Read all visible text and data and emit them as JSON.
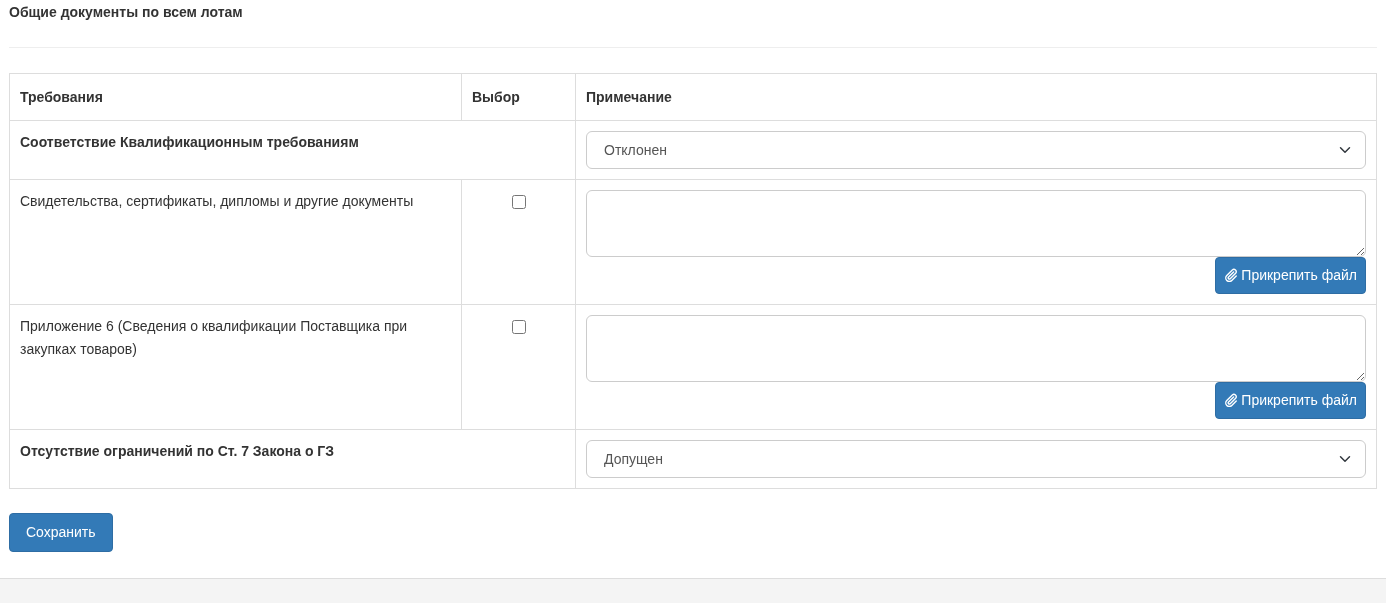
{
  "heading": "Общие документы по всем лотам",
  "table": {
    "columns": [
      "Требования",
      "Выбор",
      "Примечание"
    ],
    "rows": [
      {
        "kind": "group",
        "requirement": "Соответствие Квалификационным требованиям",
        "status": "Отклонен"
      },
      {
        "kind": "document",
        "requirement": "Свидетельства, сертификаты, дипломы и другие документы",
        "checked": false,
        "attach_button": "Прикрепить файл"
      },
      {
        "kind": "document",
        "requirement": "Приложение 6 (Сведения о квалификации Поставщика при закупках товаров)",
        "checked": false,
        "attach_button": "Прикрепить файл"
      },
      {
        "kind": "group",
        "requirement": "Отсутствие ограничений по Ст. 7 Закона о ГЗ",
        "status": "Допущен"
      }
    ]
  },
  "save_button": "Сохранить"
}
